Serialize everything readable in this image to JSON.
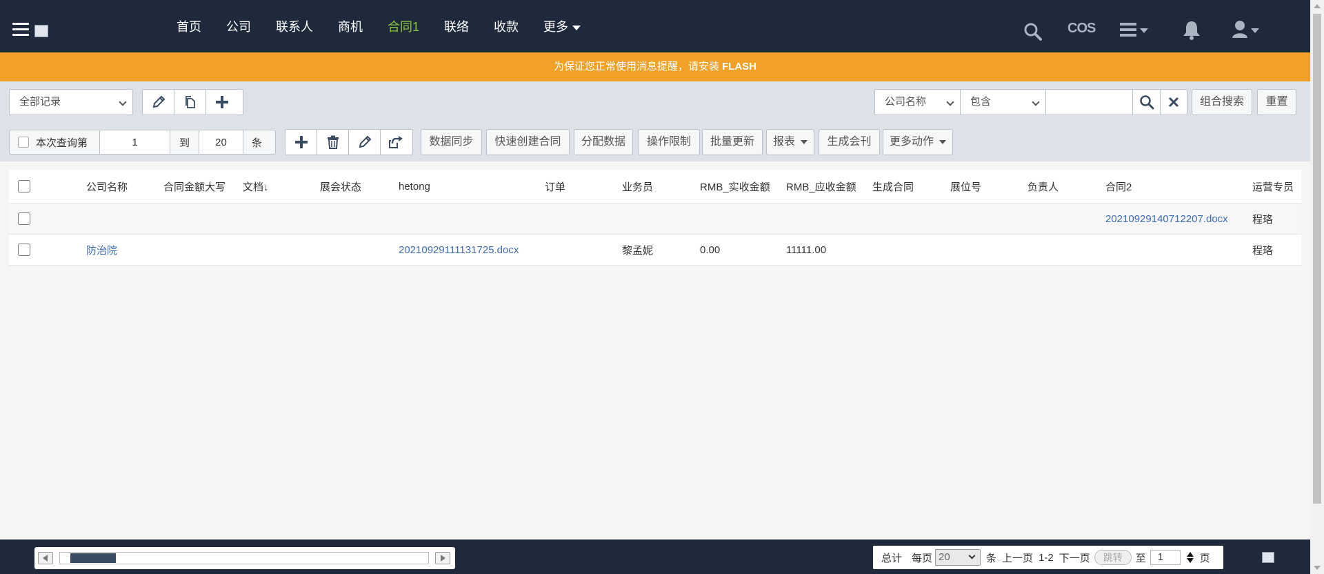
{
  "nav": {
    "items": [
      {
        "label": "首页"
      },
      {
        "label": "公司"
      },
      {
        "label": "联系人"
      },
      {
        "label": "商机"
      },
      {
        "label": "合同1",
        "active": true
      },
      {
        "label": "联络"
      },
      {
        "label": "收款"
      },
      {
        "label": "更多"
      }
    ],
    "cos_label": "COS",
    "active_color": "#8cc63f",
    "bar_color": "#1e2a3b"
  },
  "notice": {
    "text": "为保证您正常使用消息提醒，请安装",
    "highlight": "FLASH",
    "color": "#f0a126"
  },
  "toolbar": {
    "view_select": "全部记录",
    "search_field": "公司名称",
    "search_op": "包含",
    "search_value": "",
    "combo_search": "组合搜索",
    "reset": "重置"
  },
  "actionbar": {
    "query_label": "本次查询第",
    "from": "1",
    "to_label": "到",
    "to": "20",
    "unit": "条",
    "buttons": [
      "数据同步",
      "快速创建合同",
      "分配数据",
      "操作限制",
      "批量更新",
      "报表",
      "生成会刊",
      "更多动作"
    ]
  },
  "table": {
    "columns": [
      "公司名称",
      "合同金额大写",
      "文档↓",
      "展会状态",
      "hetong",
      "订单",
      "业务员",
      "RMB_实收金额",
      "RMB_应收金额",
      "生成合同",
      "展位号",
      "负责人",
      "合同2",
      "运营专员"
    ],
    "rows": [
      {
        "company": "",
        "amount_words": "",
        "doc": "",
        "expo_status": "",
        "hetong": "",
        "order": "",
        "salesman": "",
        "rmb_received": "",
        "rmb_receivable": "",
        "gen_contract": "",
        "booth": "",
        "owner": "",
        "contract2": "20210929140712207.docx",
        "ops": "程珞"
      },
      {
        "company": "防治院",
        "amount_words": "",
        "doc": "",
        "expo_status": "",
        "hetong": "20210929111131725.docx",
        "order": "",
        "salesman": "黎孟妮",
        "rmb_received": "0.00",
        "rmb_receivable": "11111.00",
        "gen_contract": "",
        "booth": "",
        "owner": "",
        "contract2": "",
        "ops": "程珞"
      }
    ]
  },
  "pagination": {
    "total_label": "总计",
    "per_page_label": "每页",
    "per_page": "20",
    "unit": "条",
    "prev": "上一页",
    "range": "1-2",
    "next": "下一页",
    "jump": "跳转",
    "to_label": "至",
    "page": "1",
    "page_unit": "页"
  }
}
